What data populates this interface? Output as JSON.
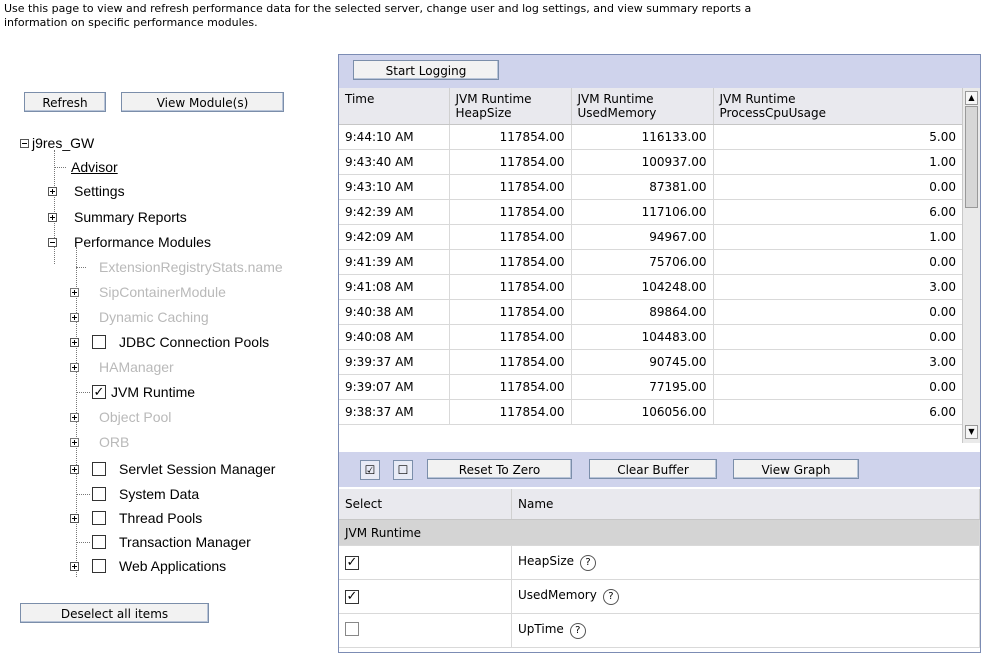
{
  "intro": {
    "line1": "Use this page to view and refresh performance data for the selected server, change user and log settings, and view summary reports a",
    "line2": "information on specific performance modules."
  },
  "left": {
    "refresh_label": "Refresh",
    "view_modules_label": "View Module(s)",
    "deselect_label": "Deselect all items"
  },
  "tree": {
    "root": "j9res_GW",
    "advisor": "Advisor",
    "settings": "Settings",
    "summary_reports": "Summary Reports",
    "performance_modules": "Performance Modules",
    "modules": [
      "ExtensionRegistryStats.name",
      "SipContainerModule",
      "Dynamic Caching",
      "JDBC Connection Pools",
      "HAManager",
      "JVM Runtime",
      "Object Pool",
      "ORB",
      "Servlet Session Manager",
      "System Data",
      "Thread Pools",
      "Transaction Manager",
      "Web Applications"
    ]
  },
  "toolbar": {
    "start_logging": "Start Logging",
    "reset_to_zero": "Reset To Zero",
    "clear_buffer": "Clear Buffer",
    "view_graph": "View Graph"
  },
  "data_table": {
    "headers": [
      [
        "Time",
        ""
      ],
      [
        "JVM Runtime",
        "HeapSize"
      ],
      [
        "JVM Runtime",
        "UsedMemory"
      ],
      [
        "JVM Runtime",
        "ProcessCpuUsage"
      ]
    ],
    "rows": [
      [
        "9:44:10 AM",
        "117854.00",
        "116133.00",
        "5.00"
      ],
      [
        "9:43:40 AM",
        "117854.00",
        "100937.00",
        "1.00"
      ],
      [
        "9:43:10 AM",
        "117854.00",
        "87381.00",
        "0.00"
      ],
      [
        "9:42:39 AM",
        "117854.00",
        "117106.00",
        "6.00"
      ],
      [
        "9:42:09 AM",
        "117854.00",
        "94967.00",
        "1.00"
      ],
      [
        "9:41:39 AM",
        "117854.00",
        "75706.00",
        "0.00"
      ],
      [
        "9:41:08 AM",
        "117854.00",
        "104248.00",
        "3.00"
      ],
      [
        "9:40:38 AM",
        "117854.00",
        "89864.00",
        "0.00"
      ],
      [
        "9:40:08 AM",
        "117854.00",
        "104483.00",
        "0.00"
      ],
      [
        "9:39:37 AM",
        "117854.00",
        "90745.00",
        "3.00"
      ],
      [
        "9:39:07 AM",
        "117854.00",
        "77195.00",
        "0.00"
      ],
      [
        "9:38:37 AM",
        "117854.00",
        "106056.00",
        "6.00"
      ]
    ]
  },
  "select_table": {
    "col_select": "Select",
    "col_name": "Name",
    "group": "JVM Runtime",
    "rows": [
      {
        "name": "HeapSize",
        "checked": true
      },
      {
        "name": "UsedMemory",
        "checked": true
      },
      {
        "name": "UpTime",
        "checked": false
      }
    ]
  },
  "colors": {
    "toolbar_bg": "#cfd3ec",
    "header_bg": "#e9e9ee",
    "group_bg": "#d4d4d4",
    "disabled_text": "#b9b9b9"
  }
}
